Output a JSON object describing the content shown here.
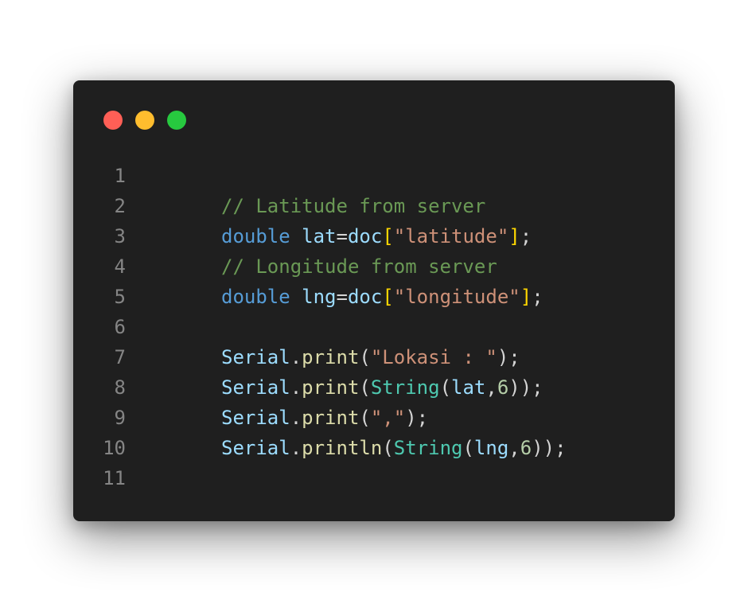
{
  "window": {
    "controls": [
      {
        "name": "close",
        "color": "#ff5f56"
      },
      {
        "name": "minimize",
        "color": "#ffbd2e"
      },
      {
        "name": "maximize",
        "color": "#27c93f"
      }
    ]
  },
  "code": {
    "line_numbers": [
      "1",
      "2",
      "3",
      "4",
      "5",
      "6",
      "7",
      "8",
      "9",
      "10",
      "11"
    ],
    "lines": [
      [],
      [
        {
          "t": "// Latitude from server",
          "c": "comment"
        }
      ],
      [
        {
          "t": "double",
          "c": "kw"
        },
        {
          "t": " ",
          "c": "punc"
        },
        {
          "t": "lat",
          "c": "var"
        },
        {
          "t": "=",
          "c": "punc"
        },
        {
          "t": "doc",
          "c": "var"
        },
        {
          "t": "[",
          "c": "br1"
        },
        {
          "t": "\"latitude\"",
          "c": "str"
        },
        {
          "t": "]",
          "c": "br1"
        },
        {
          "t": ";",
          "c": "punc"
        }
      ],
      [
        {
          "t": "// Longitude from server",
          "c": "comment"
        }
      ],
      [
        {
          "t": "double",
          "c": "kw"
        },
        {
          "t": " ",
          "c": "punc"
        },
        {
          "t": "lng",
          "c": "var"
        },
        {
          "t": "=",
          "c": "punc"
        },
        {
          "t": "doc",
          "c": "var"
        },
        {
          "t": "[",
          "c": "br1"
        },
        {
          "t": "\"longitude\"",
          "c": "str"
        },
        {
          "t": "]",
          "c": "br1"
        },
        {
          "t": ";",
          "c": "punc"
        }
      ],
      [],
      [
        {
          "t": "Serial",
          "c": "var"
        },
        {
          "t": ".",
          "c": "punc"
        },
        {
          "t": "print",
          "c": "fn"
        },
        {
          "t": "(",
          "c": "punc"
        },
        {
          "t": "\"Lokasi : \"",
          "c": "str"
        },
        {
          "t": ");",
          "c": "punc"
        }
      ],
      [
        {
          "t": "Serial",
          "c": "var"
        },
        {
          "t": ".",
          "c": "punc"
        },
        {
          "t": "print",
          "c": "fn"
        },
        {
          "t": "(",
          "c": "punc"
        },
        {
          "t": "String",
          "c": "type"
        },
        {
          "t": "(",
          "c": "punc"
        },
        {
          "t": "lat",
          "c": "var"
        },
        {
          "t": ",",
          "c": "punc"
        },
        {
          "t": "6",
          "c": "num"
        },
        {
          "t": "));",
          "c": "punc"
        }
      ],
      [
        {
          "t": "Serial",
          "c": "var"
        },
        {
          "t": ".",
          "c": "punc"
        },
        {
          "t": "print",
          "c": "fn"
        },
        {
          "t": "(",
          "c": "punc"
        },
        {
          "t": "\",\"",
          "c": "str"
        },
        {
          "t": ");",
          "c": "punc"
        }
      ],
      [
        {
          "t": "Serial",
          "c": "var"
        },
        {
          "t": ".",
          "c": "punc"
        },
        {
          "t": "println",
          "c": "fn"
        },
        {
          "t": "(",
          "c": "punc"
        },
        {
          "t": "String",
          "c": "type"
        },
        {
          "t": "(",
          "c": "punc"
        },
        {
          "t": "lng",
          "c": "var"
        },
        {
          "t": ",",
          "c": "punc"
        },
        {
          "t": "6",
          "c": "num"
        },
        {
          "t": "));",
          "c": "punc"
        }
      ],
      []
    ]
  }
}
